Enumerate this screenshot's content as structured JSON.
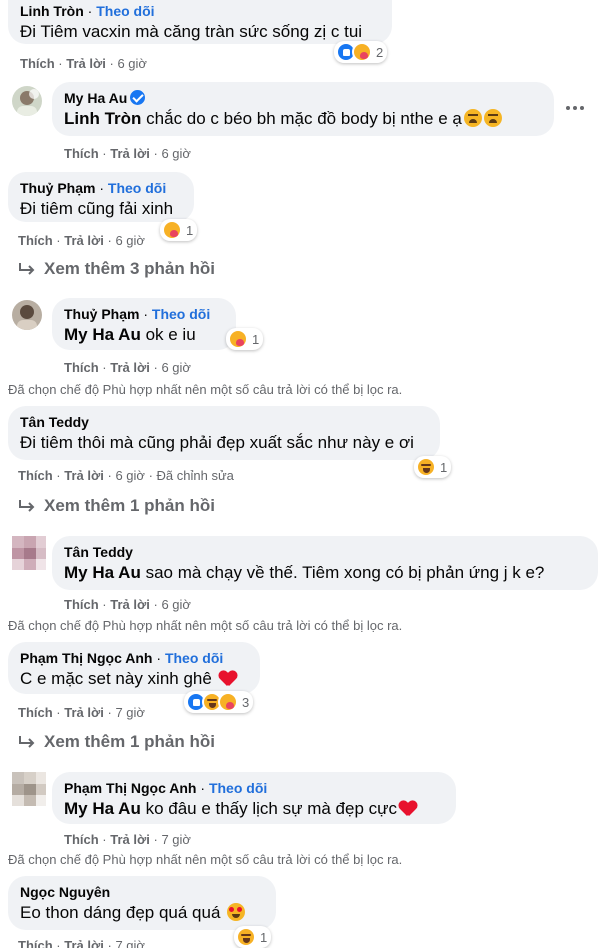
{
  "ui": {
    "follow": "Theo dõi",
    "like": "Thích",
    "reply": "Trả lời",
    "sep": "·",
    "edited": "Đã chỉnh sửa",
    "filter_notice": "Đã chọn chế độ Phù hợp nhất nên một số câu trả lời có thể bị lọc ra."
  },
  "colors": {
    "follow_link": "#216fdb",
    "meta_text": "#65676b",
    "bubble_bg": "#f0f2f5"
  },
  "comments": [
    {
      "name": "Linh Tròn",
      "follow": true,
      "text": "Đi Tiêm vacxin mà căng tràn sức sống zị c tui",
      "time": "6 giờ",
      "reaction_count": "2",
      "reactions": [
        "like-icon",
        "care-icon"
      ]
    },
    {
      "name": "My Ha Au",
      "verified": true,
      "mention": "Linh Tròn",
      "text": "chắc do c béo bh mặc đồ body bị nthe e ạ",
      "emoji": [
        "tired-face-icon",
        "tired-face-icon"
      ],
      "time": "6 giờ"
    },
    {
      "name": "Thuỷ Phạm",
      "follow": true,
      "text": "Đi tiêm cũng fải xinh",
      "time": "6 giờ",
      "reaction_count": "1",
      "reactions": [
        "care-icon"
      ]
    },
    {
      "name": "Thuỷ Phạm",
      "follow": true,
      "mention": "My Ha Au",
      "text": "ok e iu",
      "time": "6 giờ",
      "reaction_count": "1",
      "reactions": [
        "care-icon"
      ]
    },
    {
      "name": "Tân Teddy",
      "text": "Đi tiêm thôi mà cũng phải đẹp xuất sắc như này e ơi",
      "time": "6 giờ",
      "reaction_count": "1",
      "reactions": [
        "haha-icon"
      ]
    },
    {
      "name": "Tân Teddy",
      "mention": "My Ha Au",
      "text": "sao mà chạy về thế. Tiêm xong có bị phản ứng j k e?",
      "time": "6 giờ"
    },
    {
      "name": "Phạm Thị Ngọc Anh",
      "follow": true,
      "text": "C e mặc set này xinh ghê",
      "emoji": [
        "red-heart-icon"
      ],
      "time": "7 giờ",
      "reaction_count": "3",
      "reactions": [
        "like-icon",
        "haha-icon",
        "care-icon"
      ]
    },
    {
      "name": "Phạm Thị Ngọc Anh",
      "follow": true,
      "mention": "My Ha Au",
      "text": "ko đâu e thấy lịch sự mà đẹp cực",
      "emoji": [
        "red-heart-icon"
      ],
      "time": "7 giờ"
    },
    {
      "name": "Ngọc Nguyên",
      "text": "Eo thon dáng đẹp quá quá",
      "emoji": [
        "heart-eyes-icon"
      ],
      "time": "7 giờ",
      "reaction_count": "1",
      "reactions": [
        "haha-icon"
      ]
    }
  ],
  "view_more": [
    {
      "label": "Xem thêm 3 phản hồi"
    },
    {
      "label": "Xem thêm 1 phản hồi"
    },
    {
      "label": "Xem thêm 1 phản hồi"
    }
  ]
}
